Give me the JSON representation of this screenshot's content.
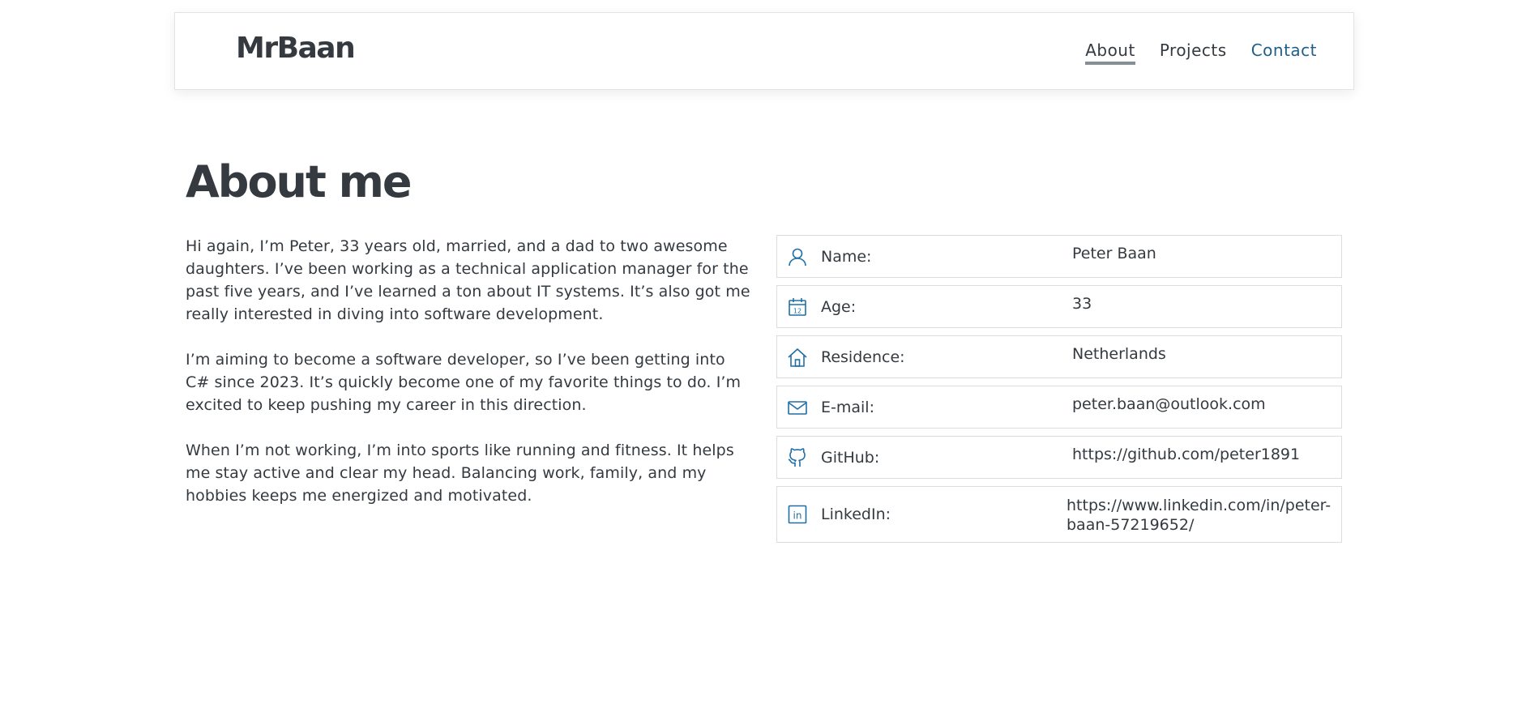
{
  "brand": "MrBaan",
  "nav": {
    "about": "About",
    "projects": "Projects",
    "contact": "Contact"
  },
  "page_title": "About me",
  "bio": [
    "Hi again, I’m Peter, 33 years old, married, and a dad to two awesome daughters. I’ve been working as a technical application manager for the past five years, and I’ve learned a ton about IT systems. It’s also got me really interested in diving into software development.",
    "I’m aiming to become a software developer, so I’ve been getting into C# since 2023. It’s quickly become one of my favorite things to do. I’m excited to keep pushing my career in this direction.",
    "When I’m not working, I’m into sports like running and fitness. It helps me stay active and clear my head. Balancing work, family, and my hobbies keeps me energized and motivated."
  ],
  "info": [
    {
      "icon": "user-icon",
      "label": "Name:",
      "value": "Peter Baan"
    },
    {
      "icon": "calendar-icon",
      "label": "Age:",
      "value": "33"
    },
    {
      "icon": "home-icon",
      "label": "Residence:",
      "value": "Netherlands"
    },
    {
      "icon": "mail-icon",
      "label": "E-mail:",
      "value": "peter.baan@outlook.com"
    },
    {
      "icon": "github-icon",
      "label": "GitHub:",
      "value": "https://github.com/peter1891"
    },
    {
      "icon": "linkedin-icon",
      "label": "LinkedIn:",
      "value": "https://www.linkedin.com/in/peter-baan-57219652/"
    }
  ],
  "colors": {
    "text": "#343a40",
    "accent": "#1f5f8b",
    "icon": "#1f6fa3",
    "active_underline": "#868e96",
    "border": "#dcdcdc"
  }
}
